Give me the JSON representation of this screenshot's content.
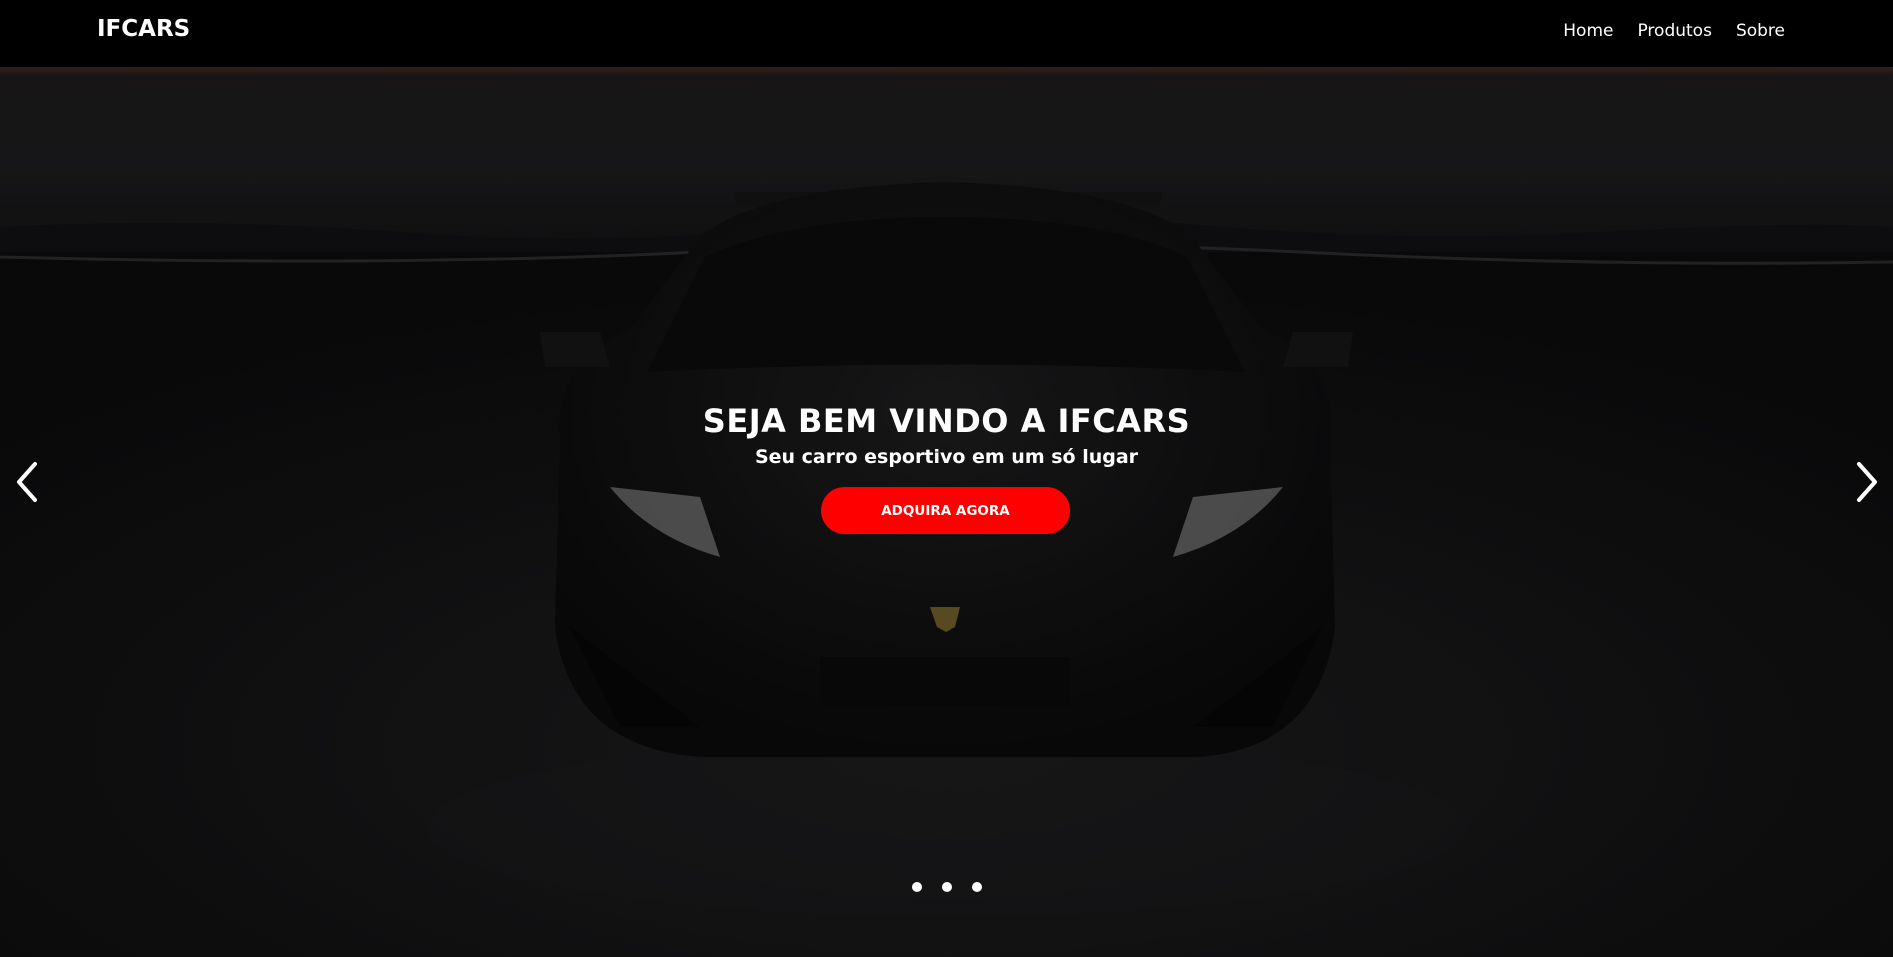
{
  "navbar": {
    "brand": "IFCARS",
    "links": [
      "Home",
      "Produtos",
      "Sobre"
    ]
  },
  "hero": {
    "title": "SEJA BEM VINDO A IFCARS",
    "subtitle": "Seu carro esportivo em um só lugar",
    "cta_label": "ADQUIRA AGORA",
    "prev_icon": "chevron-left-icon",
    "next_icon": "chevron-right-icon",
    "slide_count": 3
  },
  "colors": {
    "navbar_bg": "#000000",
    "cta_bg": "#ff0000",
    "text": "#ffffff"
  }
}
